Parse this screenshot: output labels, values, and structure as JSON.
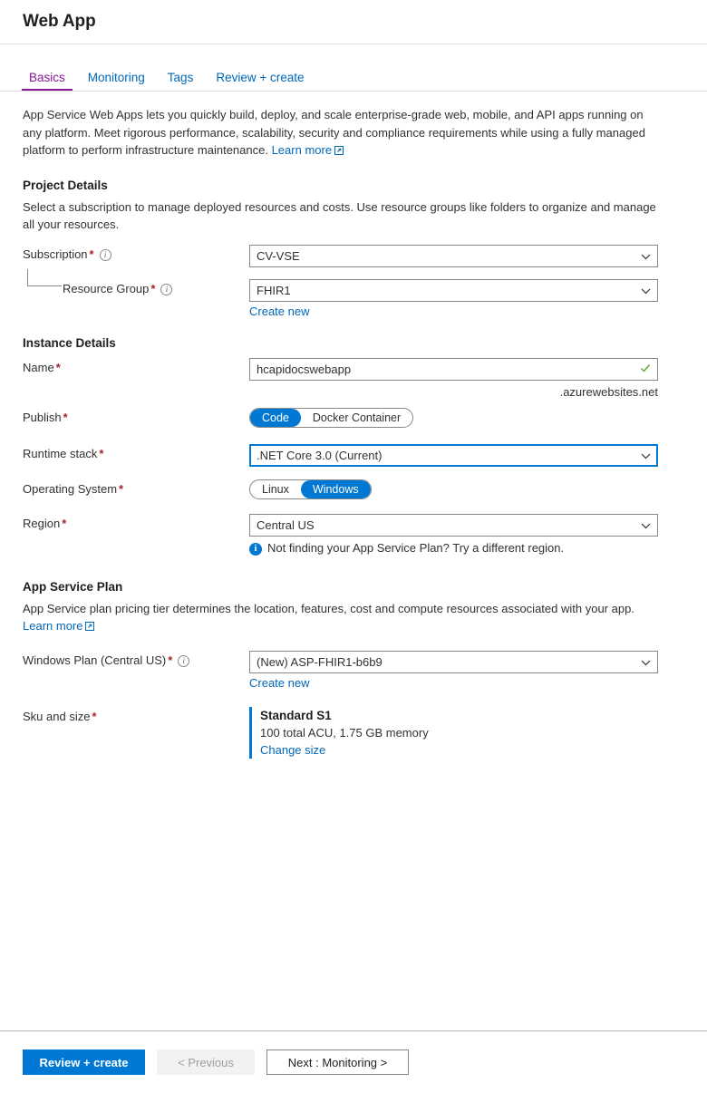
{
  "header": {
    "title": "Web App"
  },
  "tabs": [
    {
      "label": "Basics",
      "active": true
    },
    {
      "label": "Monitoring",
      "active": false
    },
    {
      "label": "Tags",
      "active": false
    },
    {
      "label": "Review + create",
      "active": false
    }
  ],
  "intro": {
    "text": "App Service Web Apps lets you quickly build, deploy, and scale enterprise-grade web, mobile, and API apps running on any platform. Meet rigorous performance, scalability, security and compliance requirements while using a fully managed platform to perform infrastructure maintenance.",
    "learn_more": "Learn more"
  },
  "project_details": {
    "heading": "Project Details",
    "description": "Select a subscription to manage deployed resources and costs. Use resource groups like folders to organize and manage all your resources.",
    "subscription": {
      "label": "Subscription",
      "value": "CV-VSE"
    },
    "resource_group": {
      "label": "Resource Group",
      "value": "FHIR1",
      "create_new": "Create new"
    }
  },
  "instance_details": {
    "heading": "Instance Details",
    "name": {
      "label": "Name",
      "value": "hcapidocswebapp",
      "suffix": ".azurewebsites.net"
    },
    "publish": {
      "label": "Publish",
      "options": [
        "Code",
        "Docker Container"
      ],
      "selected": "Code"
    },
    "runtime_stack": {
      "label": "Runtime stack",
      "value": ".NET Core 3.0 (Current)"
    },
    "operating_system": {
      "label": "Operating System",
      "options": [
        "Linux",
        "Windows"
      ],
      "selected": "Windows"
    },
    "region": {
      "label": "Region",
      "value": "Central US",
      "notice": "Not finding your App Service Plan? Try a different region."
    }
  },
  "app_service_plan": {
    "heading": "App Service Plan",
    "description": "App Service plan pricing tier determines the location, features, cost and compute resources associated with your app.",
    "learn_more": "Learn more",
    "windows_plan": {
      "label": "Windows Plan (Central US)",
      "value": "(New) ASP-FHIR1-b6b9",
      "create_new": "Create new"
    },
    "sku_and_size": {
      "label": "Sku and size",
      "tier": "Standard S1",
      "details": "100 total ACU, 1.75 GB memory",
      "change_size": "Change size"
    }
  },
  "footer": {
    "review_create": "Review + create",
    "previous": "< Previous",
    "next": "Next : Monitoring >"
  },
  "colors": {
    "accent": "#0078d4",
    "link": "#0067b8",
    "active_tab": "#881798",
    "required": "#a4262c",
    "valid": "#5ca52f"
  },
  "icons": {
    "info": "info-icon",
    "external_link": "external-link-icon",
    "chevron_down": "chevron-down-icon",
    "checkmark": "checkmark-icon"
  }
}
